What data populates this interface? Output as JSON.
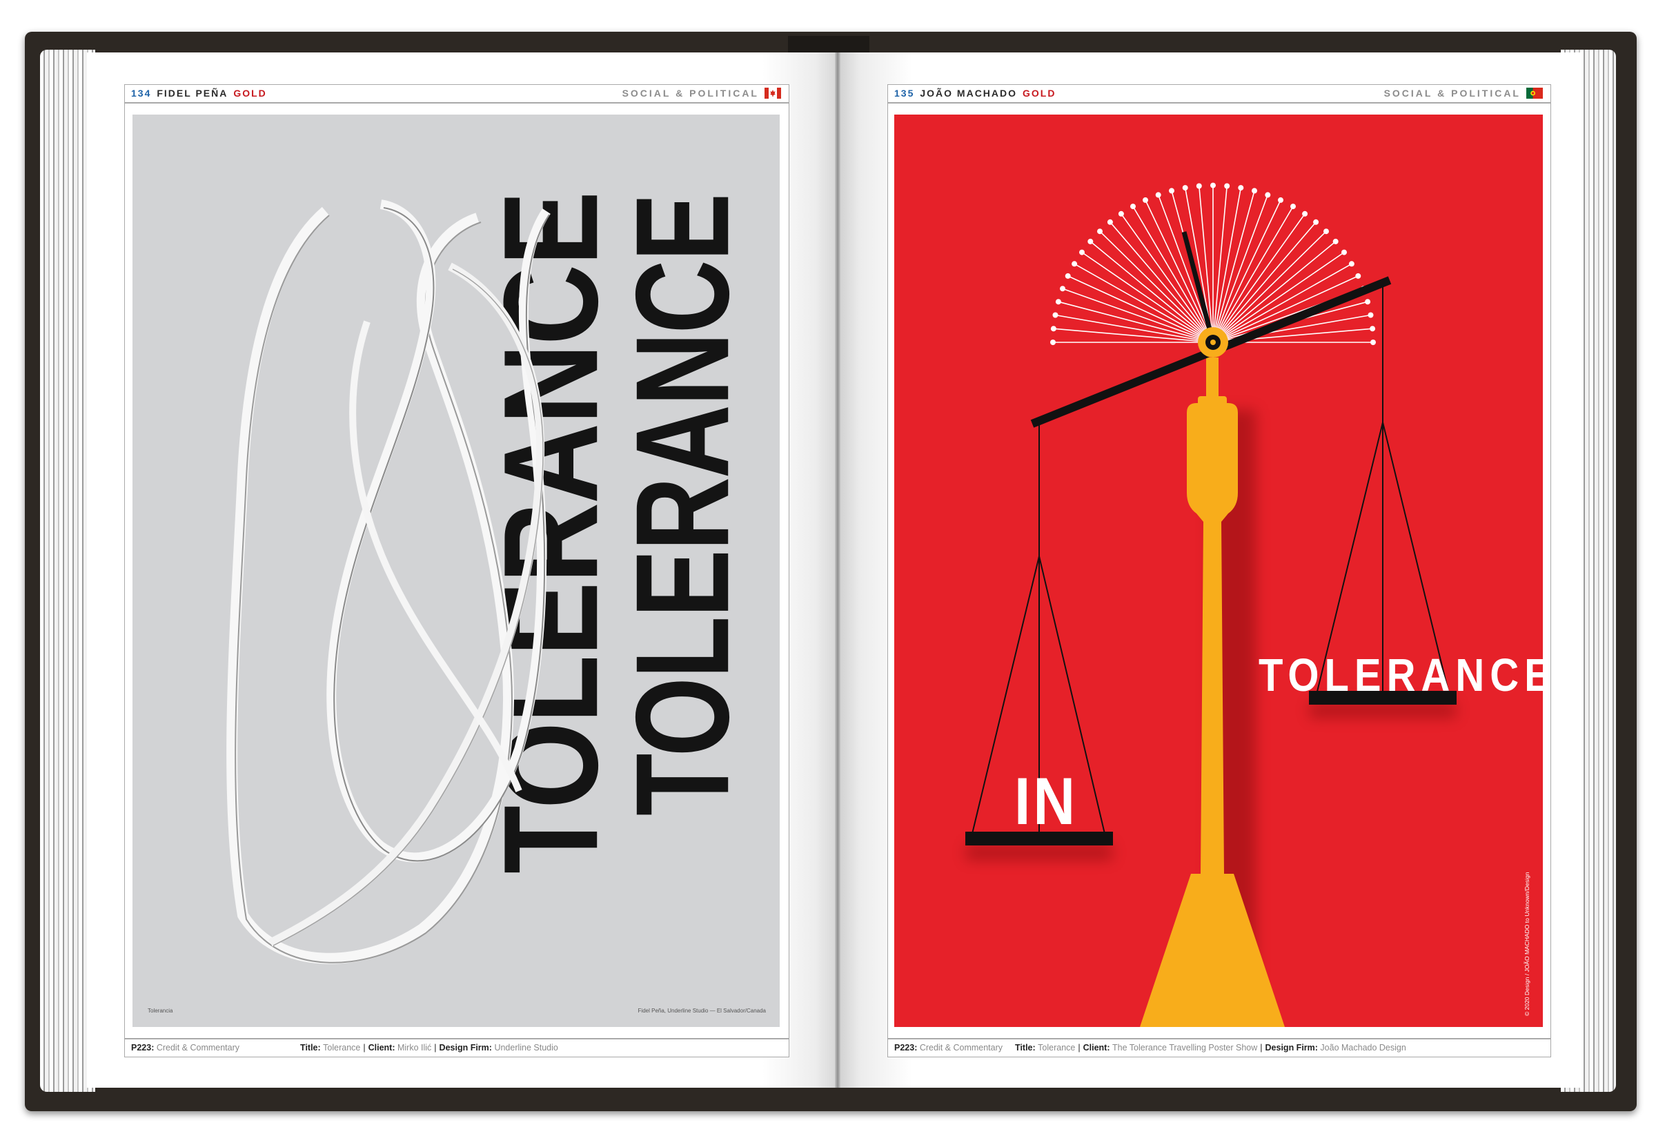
{
  "left_page": {
    "number": "134",
    "designer": "FIDEL PEÑA",
    "award": "GOLD",
    "category": "SOCIAL & POLITICAL",
    "flag_icon": "canada-flag-icon",
    "poster": {
      "headline_a": "TOLERANCE",
      "headline_b": "TOLERANCE",
      "caption_left": "Tolerancia",
      "caption_right": "Fidel Peña, Underline Studio — El Salvador/Canada"
    },
    "footer": {
      "ref_label": "P223:",
      "ref_text": "Credit & Commentary",
      "title_label": "Title:",
      "title": "Tolerance",
      "client_label": "Client:",
      "client": "Mirko Ilić",
      "firm_label": "Design Firm:",
      "firm": "Underline Studio"
    }
  },
  "right_page": {
    "number": "135",
    "designer": "JOÃO MACHADO",
    "award": "GOLD",
    "category": "SOCIAL & POLITICAL",
    "flag_icon": "portugal-flag-icon",
    "poster": {
      "word_in": "IN",
      "word_tolerance": "TOLERANCE",
      "copyright": "© 2020 Design / JOÃO MACHADO to Unknown/Design"
    },
    "footer": {
      "ref_label": "P223:",
      "ref_text": "Credit & Commentary",
      "title_label": "Title:",
      "title": "Tolerance",
      "client_label": "Client:",
      "client": "The Tolerance Travelling Poster Show",
      "firm_label": "Design Firm:",
      "firm": "João Machado Design"
    }
  },
  "colors": {
    "poster_red": "#e62129",
    "poster_yellow": "#f8ad1b",
    "poster_gray": "#d2d3d5",
    "number_blue": "#1e63a8",
    "gold_red": "#c7191f"
  }
}
